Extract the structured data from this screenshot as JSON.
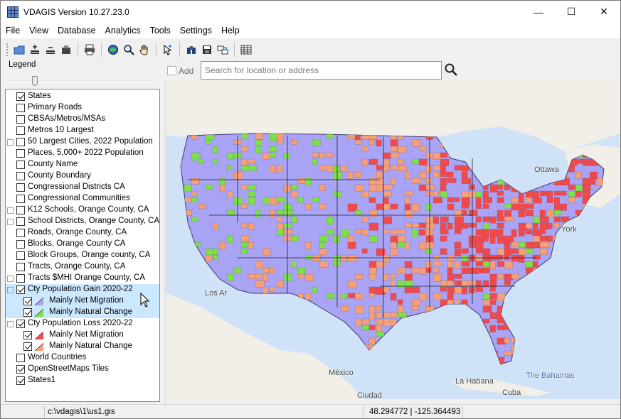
{
  "window": {
    "title": "VDAGIS Version 10.27.23.0",
    "controls": {
      "minimize": "—",
      "maximize": "☐",
      "close": "✕"
    }
  },
  "menu": [
    "File",
    "View",
    "Database",
    "Analytics",
    "Tools",
    "Settings",
    "Help"
  ],
  "toolbar": {
    "groups": [
      [
        "open-icon",
        "add-layer-icon",
        "remove-layer-icon",
        "save-layer-icon"
      ],
      [
        "print-icon"
      ],
      [
        "globe-icon",
        "zoom-icon",
        "pan-hand-icon"
      ],
      [
        "select-pointer-icon"
      ],
      [
        "binoculars-icon",
        "disk-icon",
        "swap-icon"
      ],
      [
        "table-icon"
      ]
    ]
  },
  "legend": {
    "title": "Legend",
    "items": [
      {
        "label": "States",
        "checked": true,
        "expander": false,
        "indent": 0
      },
      {
        "label": "Primary Roads",
        "checked": false,
        "expander": false,
        "indent": 0
      },
      {
        "label": "CBSAs/Metros/MSAs",
        "checked": false,
        "expander": false,
        "indent": 0
      },
      {
        "label": "Metros 10 Largest",
        "checked": false,
        "expander": false,
        "indent": 0
      },
      {
        "label": "50 Largest Cities, 2022 Population",
        "checked": false,
        "expander": true,
        "indent": 0
      },
      {
        "label": "Places, 5,000+ 2022 Population",
        "checked": false,
        "expander": false,
        "indent": 0
      },
      {
        "label": "County Name",
        "checked": false,
        "expander": false,
        "indent": 0
      },
      {
        "label": "County Boundary",
        "checked": false,
        "expander": false,
        "indent": 0
      },
      {
        "label": "Congressional Districts CA",
        "checked": false,
        "expander": false,
        "indent": 0
      },
      {
        "label": "Congressional Communities",
        "checked": false,
        "expander": false,
        "indent": 0
      },
      {
        "label": "K12 Schools, Orange County, CA",
        "checked": false,
        "expander": true,
        "indent": 0
      },
      {
        "label": "School Districts, Orange County, CA",
        "checked": false,
        "expander": true,
        "indent": 0
      },
      {
        "label": "Roads, Orange County, CA",
        "checked": false,
        "expander": false,
        "indent": 0
      },
      {
        "label": "Blocks, Orange County CA",
        "checked": false,
        "expander": false,
        "indent": 0
      },
      {
        "label": "Block Groups, Orange county, CA",
        "checked": false,
        "expander": false,
        "indent": 0
      },
      {
        "label": "Tracts, Orange County, CA",
        "checked": false,
        "expander": false,
        "indent": 0
      },
      {
        "label": "Tracts $MHI Orange County, CA",
        "checked": false,
        "expander": true,
        "indent": 0
      },
      {
        "label": "Cty Population Gain 2020-22",
        "checked": true,
        "expander": true,
        "indent": 0,
        "selected": true
      },
      {
        "label": "Mainly Net Migration",
        "checked": true,
        "expander": false,
        "indent": 1,
        "swatch": "#a9a4f5",
        "selected": true
      },
      {
        "label": "Mainly Natural Change",
        "checked": true,
        "expander": false,
        "indent": 1,
        "swatch": "#7ee04a",
        "selected": true
      },
      {
        "label": "Cty Population Loss 2020-22",
        "checked": true,
        "expander": true,
        "indent": 0
      },
      {
        "label": "Mainly Net Migration",
        "checked": true,
        "expander": false,
        "indent": 1,
        "swatch": "#f2494a"
      },
      {
        "label": "Mainly Natural Change",
        "checked": true,
        "expander": false,
        "indent": 1,
        "swatch": "#f6a079"
      },
      {
        "label": "World Countries",
        "checked": false,
        "expander": false,
        "indent": 0
      },
      {
        "label": "OpenStreetMaps Tiles",
        "checked": true,
        "expander": false,
        "indent": 0
      },
      {
        "label": "States1",
        "checked": true,
        "expander": false,
        "indent": 0
      }
    ]
  },
  "search": {
    "add_label": "Add",
    "placeholder": "Search for location or address"
  },
  "map": {
    "labels": [
      "Ottawa",
      "York",
      "Los Ar",
      "México",
      "The Bahamas",
      "La Habana",
      "Cuba",
      "Ciudad"
    ],
    "colors": {
      "gain_migration": "#a9a4f5",
      "gain_natural": "#7ee04a",
      "loss_migration": "#f2494a",
      "loss_natural": "#f6a079",
      "water": "#cfe2f7",
      "land": "#f2efe9"
    }
  },
  "status": {
    "path": "c:\\vdagis\\1\\us1.gis",
    "coords": "48.294772 | -125.364493"
  }
}
